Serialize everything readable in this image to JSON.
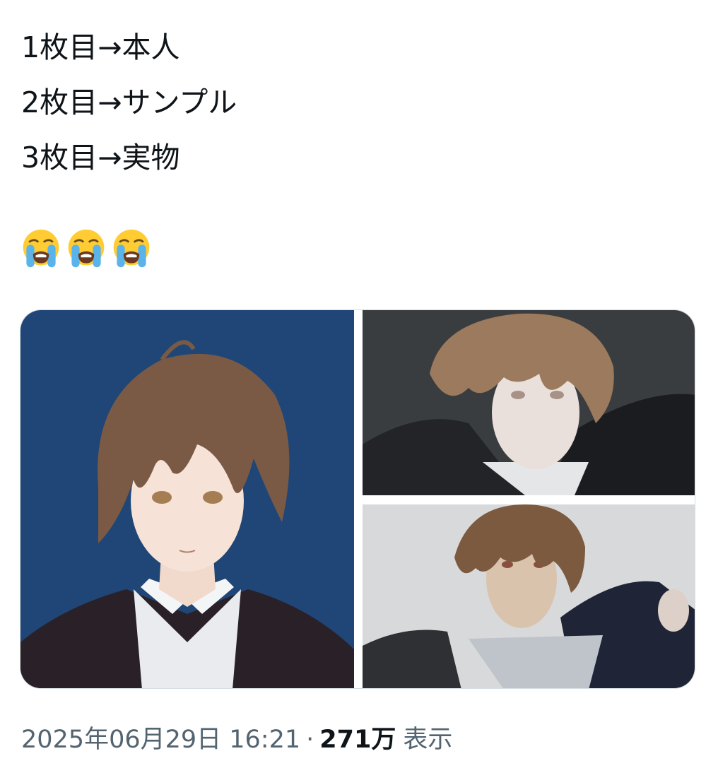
{
  "tweet": {
    "lines": [
      "1枚目→本人",
      "2枚目→サンプル",
      "3枚目→実物"
    ],
    "emoji_count": 3,
    "emoji_name": "loudly-crying-face-icon"
  },
  "media": [
    {
      "index": 1,
      "kind": "illustration",
      "background": "#1f4676"
    },
    {
      "index": 2,
      "kind": "figure-sample-photo",
      "background": "#3a3d40"
    },
    {
      "index": 3,
      "kind": "figure-actual-photo",
      "background": "#d8d9db"
    }
  ],
  "meta": {
    "timestamp": "2025年06月29日 16:21",
    "separator": "·",
    "views_count": "271万",
    "views_label": "表示"
  },
  "colors": {
    "text": "#0f1419",
    "secondary": "#536471",
    "border": "#d8dde1"
  }
}
